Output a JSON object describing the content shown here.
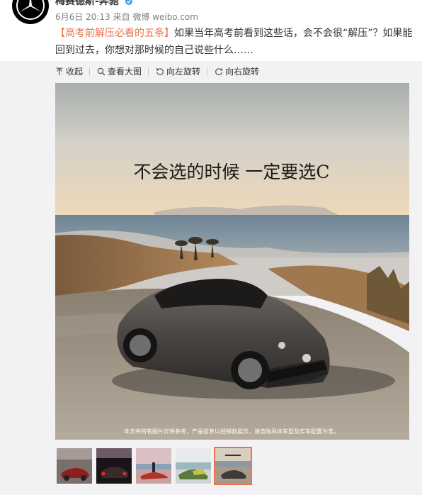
{
  "user": {
    "name": "梅赛德斯-奔驰",
    "verified": true
  },
  "meta": {
    "date": "6月6日 20:13",
    "from_label": "来自",
    "source": "微博 weibo.com"
  },
  "post": {
    "tag": "【高考前解压必看的五条】",
    "text": "如果当年高考前看到这些话，会不会很“解压”？如果能回到过去，你想对那时候的自己说些什么……"
  },
  "toolbar": {
    "collapse": "收起",
    "view_large": "查看大图",
    "rotate_left": "向左旋转",
    "rotate_right": "向右旋转"
  },
  "image": {
    "headline": "不会选的时候  一定要选C",
    "disclaimer": "本文中所有图片仅供参考，产品信息以经销商展示，请咨询具体车型及实车配置为准。"
  },
  "thumbnails": [
    {
      "id": "thumb-1",
      "active": false
    },
    {
      "id": "thumb-2",
      "active": false
    },
    {
      "id": "thumb-3",
      "active": false
    },
    {
      "id": "thumb-4",
      "active": false
    },
    {
      "id": "thumb-5",
      "active": true
    }
  ],
  "colors": {
    "accent": "#eb7350",
    "panel": "#f2f2f5",
    "meta": "#808080",
    "verified": "#4aa0e0"
  }
}
